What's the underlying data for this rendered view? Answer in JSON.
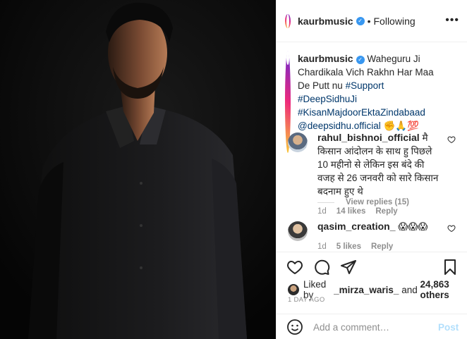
{
  "post": {
    "username": "kaurbmusic",
    "verified_mark": "✓",
    "follow_status": "Following",
    "more": "•••",
    "caption_text": "Waheguru Ji Chardikala Vich Rakhn Har Maa De Putt nu",
    "caption_tags": [
      "#Support",
      "#DeepSidhuJi",
      "#KisanMajdoorEktaZindabaad",
      "@deepsidhu.official"
    ],
    "caption_emoji": "✊🙏💯",
    "caption_time": "1d"
  },
  "comments": [
    {
      "username": "rahul_bishnoi_official",
      "text": "मै किसान आंदोलन के साथ हु पिछले 10 महीनो से लेकिन इस बंदे की वजह से 26 जनवरी को सारे किसान बदनाम हुए थे",
      "time": "1d",
      "likes": "14 likes",
      "reply": "Reply",
      "view_replies": "View replies (15)"
    },
    {
      "username": "qasim_creation_",
      "text": "😱😱😱",
      "time": "1d",
      "likes": "5 likes",
      "reply": "Reply"
    }
  ],
  "likes_summary": {
    "prefix": "Liked by",
    "user": "_mirza_waris_",
    "middle": "and",
    "count": "24,863 others"
  },
  "time_ago": "1 DAY AGO",
  "add_comment": {
    "placeholder": "Add a comment…",
    "post_label": "Post"
  },
  "icons": [
    "heart-icon",
    "comment-icon",
    "share-icon",
    "bookmark-icon",
    "emoji-icon",
    "more-icon"
  ],
  "colors": {
    "link": "#00376b",
    "verified": "#3897f0",
    "muted": "#8e8e8e",
    "post_disabled": "#b2dffc"
  }
}
